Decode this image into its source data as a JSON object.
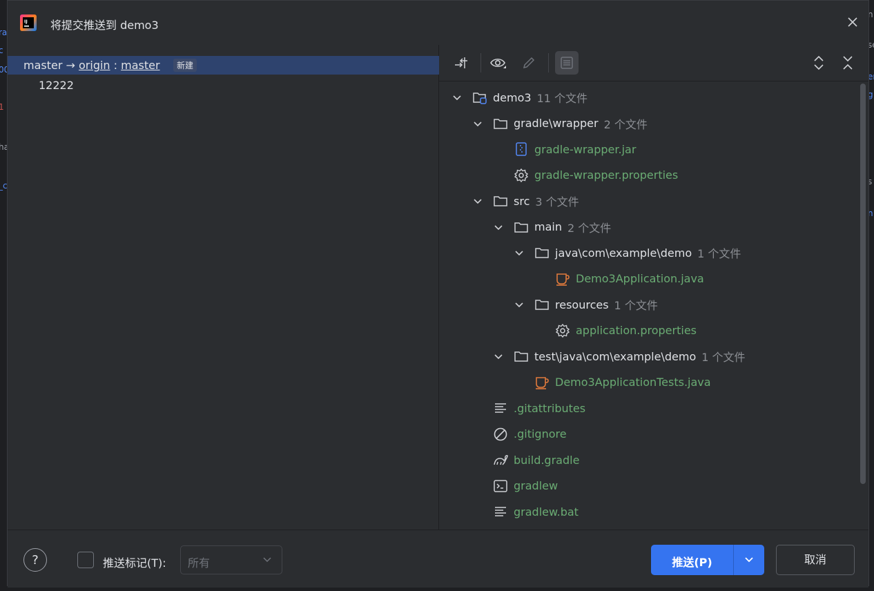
{
  "dialog": {
    "title": "将提交推送到 demo3"
  },
  "left": {
    "branch_source": "master",
    "arrow": "→",
    "remote": "origin",
    "separator": ":",
    "target_branch": "master",
    "badge": "新建",
    "commit_message": "12222"
  },
  "toolbar": {
    "icons": [
      "collapse-arrows-icon",
      "eye-icon",
      "pencil-icon",
      "diff-preview-icon",
      "expand-all-icon",
      "collapse-all-icon"
    ]
  },
  "tree": [
    {
      "name": "demo3",
      "count": "11 个文件",
      "kind": "module",
      "status": "normal"
    },
    {
      "name": "gradle\\wrapper",
      "count": "2 个文件",
      "kind": "folder",
      "status": "normal"
    },
    {
      "name": "gradle-wrapper.jar",
      "count": "",
      "kind": "jar",
      "status": "added"
    },
    {
      "name": "gradle-wrapper.properties",
      "count": "",
      "kind": "gear",
      "status": "added"
    },
    {
      "name": "src",
      "count": "3 个文件",
      "kind": "folder",
      "status": "normal"
    },
    {
      "name": "main",
      "count": "2 个文件",
      "kind": "folder",
      "status": "normal"
    },
    {
      "name": "java\\com\\example\\demo",
      "count": "1 个文件",
      "kind": "folder",
      "status": "normal"
    },
    {
      "name": "Demo3Application.java",
      "count": "",
      "kind": "java",
      "status": "added"
    },
    {
      "name": "resources",
      "count": "1 个文件",
      "kind": "folder",
      "status": "normal"
    },
    {
      "name": "application.properties",
      "count": "",
      "kind": "gear",
      "status": "added"
    },
    {
      "name": "test\\java\\com\\example\\demo",
      "count": "1 个文件",
      "kind": "folder",
      "status": "normal"
    },
    {
      "name": "Demo3ApplicationTests.java",
      "count": "",
      "kind": "java",
      "status": "added"
    },
    {
      "name": ".gitattributes",
      "count": "",
      "kind": "text",
      "status": "added"
    },
    {
      "name": ".gitignore",
      "count": "",
      "kind": "ignore",
      "status": "added"
    },
    {
      "name": "build.gradle",
      "count": "",
      "kind": "gradle",
      "status": "added"
    },
    {
      "name": "gradlew",
      "count": "",
      "kind": "terminal",
      "status": "added"
    },
    {
      "name": "gradlew.bat",
      "count": "",
      "kind": "text",
      "status": "added"
    }
  ],
  "footer": {
    "help_label": "?",
    "push_tags_label": "推送标记(T):",
    "tags_select_value": "所有",
    "push_button": "推送(P)",
    "cancel_button": "取消"
  },
  "colors": {
    "accent": "#3574f0",
    "added_file": "#6aab73",
    "selection": "#2e436e"
  }
}
